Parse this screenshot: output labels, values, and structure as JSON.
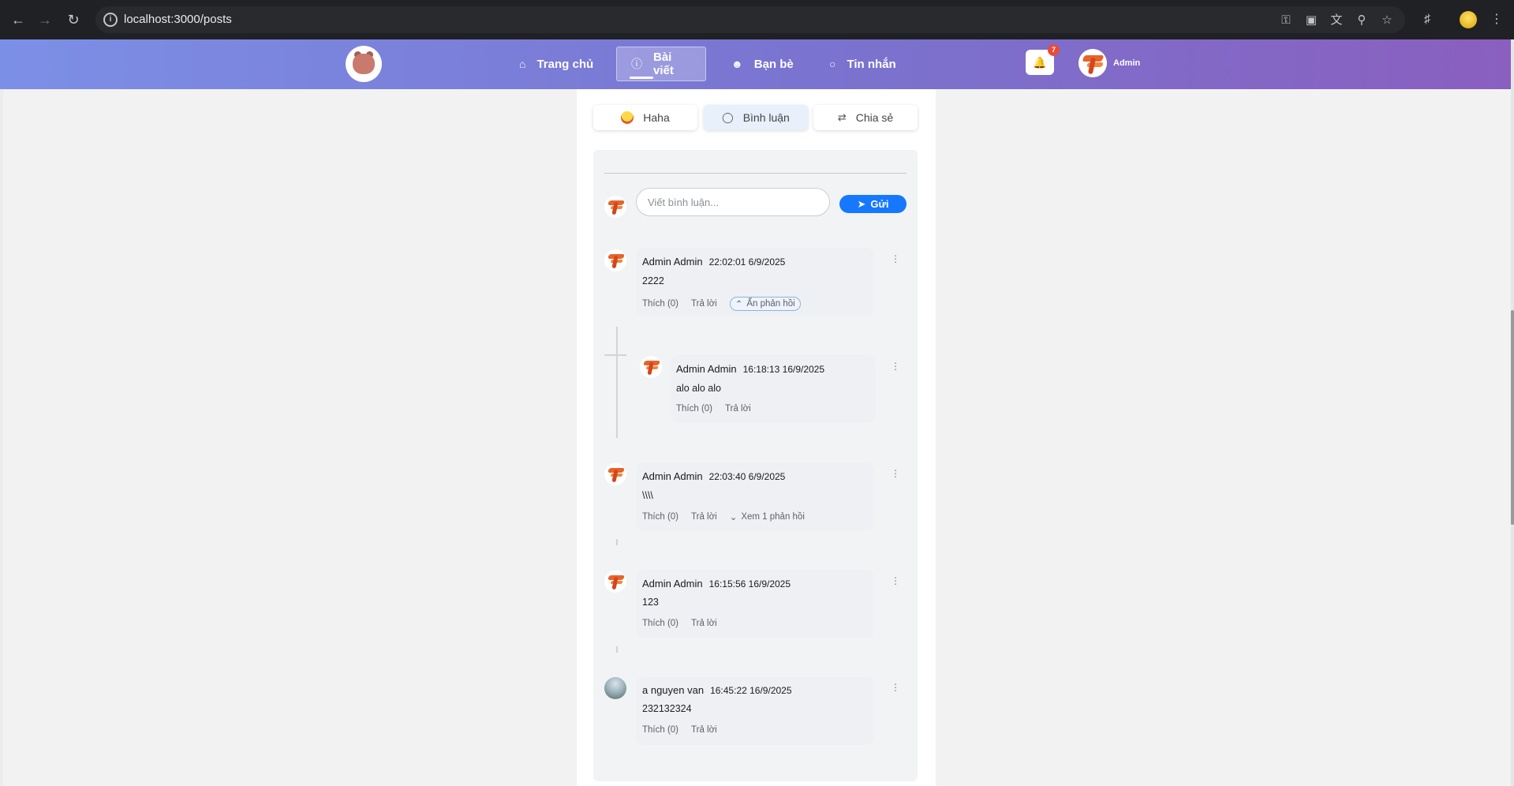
{
  "browser": {
    "url": "localhost:3000/posts",
    "icons": [
      "back-icon",
      "forward-icon",
      "reload-icon",
      "site-info-icon",
      "key-icon",
      "install-icon",
      "translate-icon",
      "zoom-icon",
      "star-icon",
      "extensions-icon",
      "profile-icon",
      "menu-icon"
    ]
  },
  "header": {
    "nav": [
      {
        "label": "Trang chủ",
        "icon": "home-icon"
      },
      {
        "label": "Bài viết",
        "icon": "info-icon"
      },
      {
        "label": "Bạn bè",
        "icon": "friends-icon"
      },
      {
        "label": "Tin nhắn",
        "icon": "message-icon"
      }
    ],
    "active_nav": "Bài viết",
    "notification_count": "7",
    "user_name": "Admin",
    "gradient": [
      "#7c8fe6",
      "#8a5fbf"
    ]
  },
  "post_actions": {
    "haha": "Haha",
    "comment": "Bình luận",
    "share": "Chia sẻ"
  },
  "composer": {
    "placeholder": "Viết bình luận...",
    "send_label": "Gửi"
  },
  "comments": [
    {
      "author": "Admin Admin",
      "time": "22:02:01 6/9/2025",
      "text": "2222",
      "like": "Thích (0)",
      "reply": "Trả lời",
      "toggle": "Ẩn phản hồi"
    },
    {
      "author": "Admin Admin",
      "time": "16:18:13 16/9/2025",
      "text": "alo alo alo",
      "like": "Thích (0)",
      "reply": "Trả lời"
    },
    {
      "author": "Admin Admin",
      "time": "22:03:40 6/9/2025",
      "text": "\\\\\\\\",
      "like": "Thích (0)",
      "reply": "Trả lời",
      "toggle": "Xem 1 phản hồi"
    },
    {
      "author": "Admin Admin",
      "time": "16:15:56 16/9/2025",
      "text": "123",
      "like": "Thích (0)",
      "reply": "Trả lời"
    },
    {
      "author": "a nguyen van",
      "time": "16:45:22 16/9/2025",
      "text": "232132324",
      "like": "Thích (0)",
      "reply": "Trả lời"
    }
  ],
  "colors": {
    "accent": "#1677ff",
    "badge": "#e74c3c"
  }
}
